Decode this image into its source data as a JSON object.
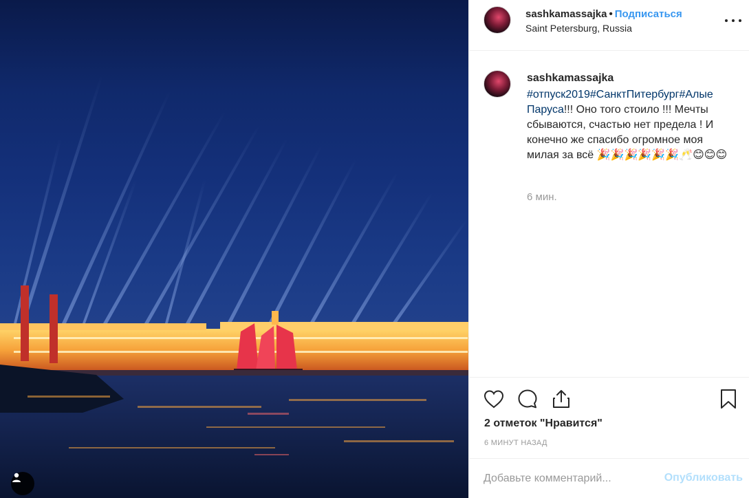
{
  "post": {
    "username": "sashkamassajka",
    "separator": "•",
    "follow_label": "Подписаться",
    "location": "Saint Petersburg, Russia",
    "more_icon": "more-horizontal-icon"
  },
  "caption": {
    "username": "sashkamassajka",
    "hashtags": "#отпуск2019#СанктПитербург#Алые Паруса",
    "text": "!!! Оно того стоило !!! Мечты сбываются, счастью нет предела ! И конечно же спасибо огромное моя милая за всё 🎉🎉🎉🎉🎉🎉🥂😊😊😊",
    "time": "6 мин."
  },
  "actions": {
    "like_icon": "heart-icon",
    "comment_icon": "comment-icon",
    "share_icon": "share-icon",
    "save_icon": "bookmark-icon",
    "likes_text": "2 отметок \"Нравится\"",
    "time_ago": "6 МИНУТ НАЗАД"
  },
  "comment": {
    "placeholder": "Добавьте комментарий...",
    "publish_label": "Опубликовать"
  },
  "colors": {
    "link_blue": "#3897f0",
    "hashtag": "#003569",
    "muted": "#999999",
    "publish_disabled": "#b2dffc"
  }
}
